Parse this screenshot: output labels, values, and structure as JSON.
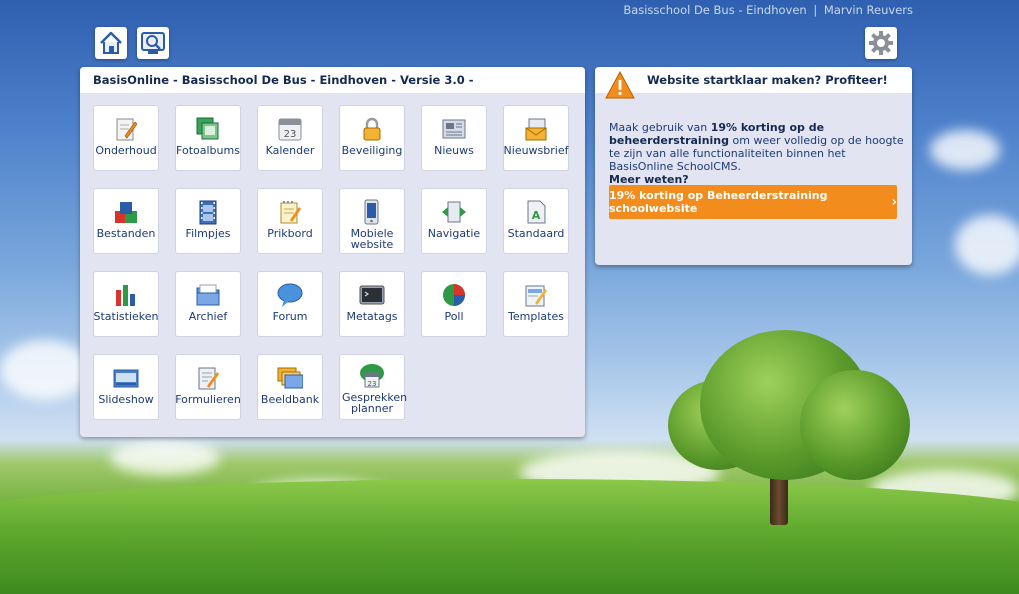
{
  "header": {
    "school": "Basisschool De Bus - Eindhoven",
    "separator": "|",
    "user": "Marvin Reuvers"
  },
  "toolbar": {
    "home_icon": "home-icon",
    "preview_icon": "preview-icon",
    "settings_icon": "gear-icon"
  },
  "main_panel": {
    "title": "BasisOnline - Basisschool De Bus - Eindhoven - Versie 3.0 -",
    "tiles": [
      {
        "label": "Onderhoud",
        "icon": "edit-icon"
      },
      {
        "label": "Fotoalbums",
        "icon": "photo-album-icon"
      },
      {
        "label": "Kalender",
        "icon": "calendar-icon"
      },
      {
        "label": "Beveiliging",
        "icon": "lock-icon"
      },
      {
        "label": "Nieuws",
        "icon": "newspaper-icon"
      },
      {
        "label": "Nieuwsbrief",
        "icon": "newsletter-icon"
      },
      {
        "label": "Bestanden",
        "icon": "files-icon"
      },
      {
        "label": "Filmpjes",
        "icon": "film-icon"
      },
      {
        "label": "Prikbord",
        "icon": "notepad-icon"
      },
      {
        "label": "Mobiele website",
        "icon": "mobile-icon"
      },
      {
        "label": "Navigatie",
        "icon": "navigation-icon"
      },
      {
        "label": "Standaard",
        "icon": "document-icon"
      },
      {
        "label": "Statistieken",
        "icon": "bar-chart-icon"
      },
      {
        "label": "Archief",
        "icon": "archive-icon"
      },
      {
        "label": "Forum",
        "icon": "speech-bubble-icon"
      },
      {
        "label": "Metatags",
        "icon": "terminal-icon"
      },
      {
        "label": "Poll",
        "icon": "pie-chart-icon"
      },
      {
        "label": "Templates",
        "icon": "template-icon"
      },
      {
        "label": "Slideshow",
        "icon": "slideshow-icon"
      },
      {
        "label": "Formulieren",
        "icon": "form-icon"
      },
      {
        "label": "Beeldbank",
        "icon": "image-bank-icon"
      },
      {
        "label": "Gesprekken planner",
        "icon": "appointment-icon"
      }
    ]
  },
  "promo_panel": {
    "title": "Website startklaar maken? Profiteer!",
    "text_pre": "Maak gebruik van ",
    "text_bold": "19% korting op de beheerderstraining",
    "text_post": " om weer volledig op de hoogte te zijn van alle functionaliteiten binnen het BasisOnline SchoolCMS.",
    "more": "Meer weten?",
    "button": "19% korting op Beheerderstraining schoolwebsite",
    "button_arrow": "›",
    "icon": "warning-icon",
    "accent": "#f28c1c"
  }
}
